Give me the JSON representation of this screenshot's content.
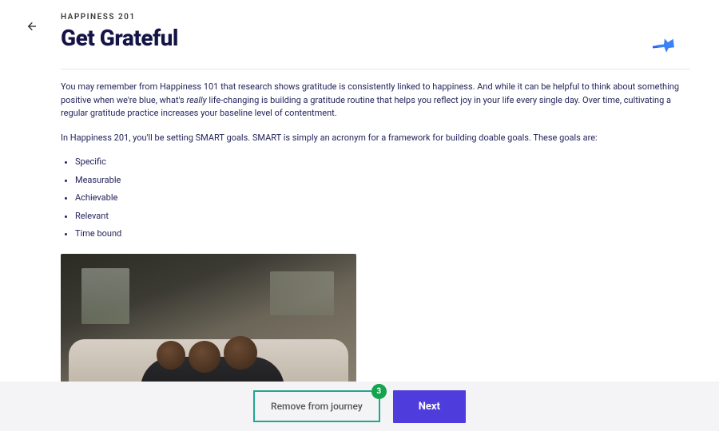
{
  "header": {
    "eyebrow": "HAPPINESS 201",
    "title": "Get Grateful"
  },
  "body": {
    "para1_a": "You may remember from Happiness 101 that research shows gratitude is consistently linked to happiness. And while it can be helpful to think about something positive when we're blue, what's ",
    "para1_em": "really",
    "para1_b": " life-changing is building a gratitude routine that helps you reflect joy in your life every single day. Over time, cultivating a regular gratitude practice increases your baseline level of contentment.",
    "para2": "In Happiness 201, you'll be setting SMART goals. SMART is simply an acronym for a framework for building doable goals. These goals are:",
    "goals": [
      "Specific",
      "Measurable",
      "Achievable",
      "Relevant",
      "Time bound"
    ]
  },
  "footer": {
    "remove_label": "Remove from journey",
    "remove_badge": "3",
    "next_label": "Next"
  },
  "icons": {
    "back": "back-arrow-icon",
    "pin": "pushpin-icon"
  }
}
